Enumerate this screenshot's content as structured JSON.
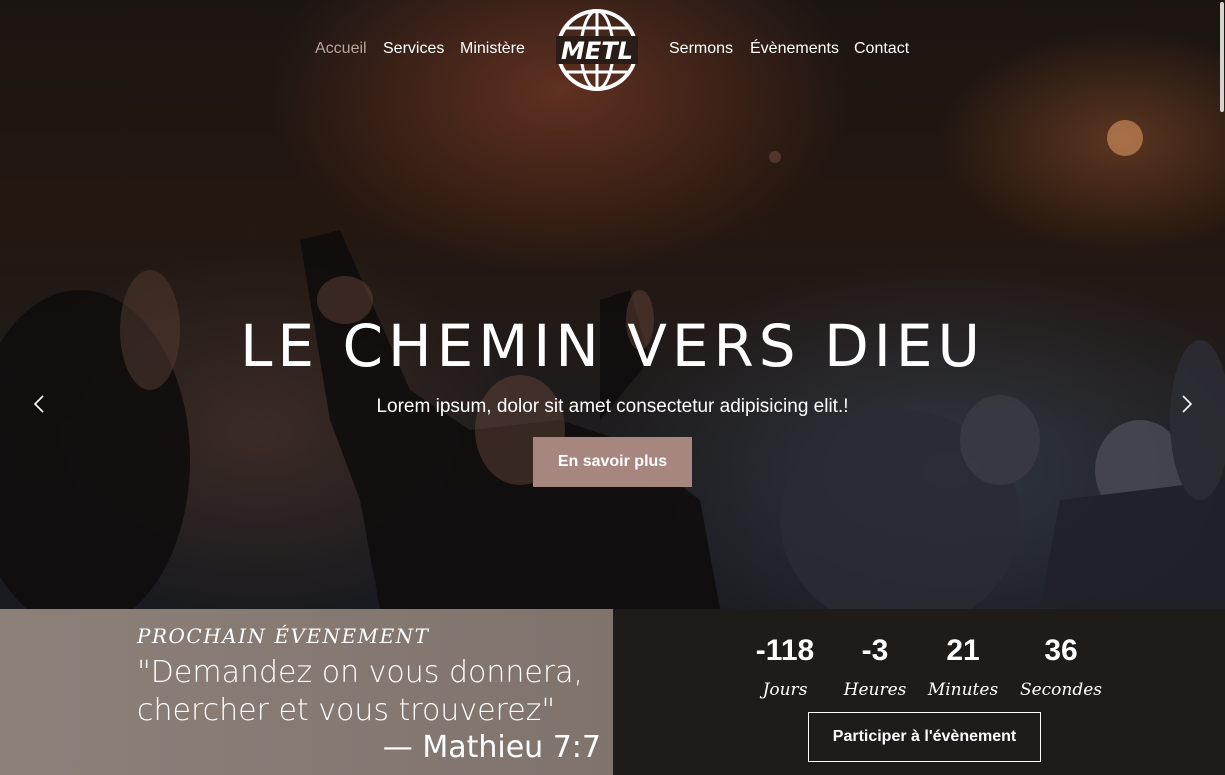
{
  "nav": {
    "items": [
      "Accueil",
      "Services",
      "Ministère",
      "Sermons",
      "Évènements",
      "Contact"
    ],
    "active": "Accueil",
    "logo_text": "METL"
  },
  "hero": {
    "title": "LE CHEMIN VERS DIEU",
    "subtitle": "Lorem ipsum, dolor sit amet consectetur adipisicing elit.!",
    "cta_label": "En savoir plus"
  },
  "event": {
    "tag": "PROCHAIN ÉVENEMENT",
    "quote_line1": "\"Demandez on vous donnera,",
    "quote_line2": "chercher et vous trouverez\"",
    "reference": "— Mathieu 7:7"
  },
  "countdown": [
    {
      "value": "-118",
      "label": "Jours"
    },
    {
      "value": "-3",
      "label": "Heures"
    },
    {
      "value": "21",
      "label": "Minutes"
    },
    {
      "value": "36",
      "label": "Secondes"
    }
  ],
  "join_label": "Participer à l'évènement",
  "colors": {
    "accent": "#a88680",
    "nav_active": "#b8a59c",
    "event_left_bg": "#867a73",
    "event_right_bg": "#1f1b18"
  },
  "icons": [
    "logo-globe-icon",
    "chevron-left-icon",
    "chevron-right-icon"
  ]
}
